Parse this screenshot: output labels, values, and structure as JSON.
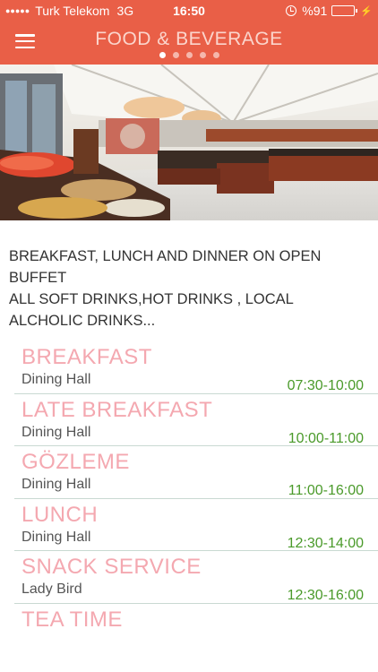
{
  "status_bar": {
    "carrier": "Turk Telekom",
    "network": "3G",
    "time": "16:50",
    "battery": "%91",
    "battery_level": 0.91
  },
  "header": {
    "title": "FOOD & BEVERAGE",
    "page_count": 5,
    "active_page": 0,
    "accent_color": "#e95f47"
  },
  "hero_image": {
    "description": "open buffet restaurant under white tent"
  },
  "intro": {
    "line1": "BREAKFAST, LUNCH AND DINNER ON OPEN BUFFET",
    "line2": "ALL SOFT DRINKS,HOT DRINKS , LOCAL ALCHOLIC DRINKS..."
  },
  "schedule": [
    {
      "title": "BREAKFAST",
      "venue": "Dining Hall",
      "time": "07:30-10:00"
    },
    {
      "title": "LATE BREAKFAST",
      "venue": "Dining Hall",
      "time": "10:00-11:00"
    },
    {
      "title": "GÖZLEME",
      "venue": "Dining Hall",
      "time": "11:00-16:00"
    },
    {
      "title": "LUNCH",
      "venue": "Dining Hall",
      "time": "12:30-14:00"
    },
    {
      "title": "SNACK SERVICE",
      "venue": "Lady Bird",
      "time": "12:30-16:00"
    },
    {
      "title": "TEA TIME",
      "venue": "",
      "time": ""
    }
  ]
}
